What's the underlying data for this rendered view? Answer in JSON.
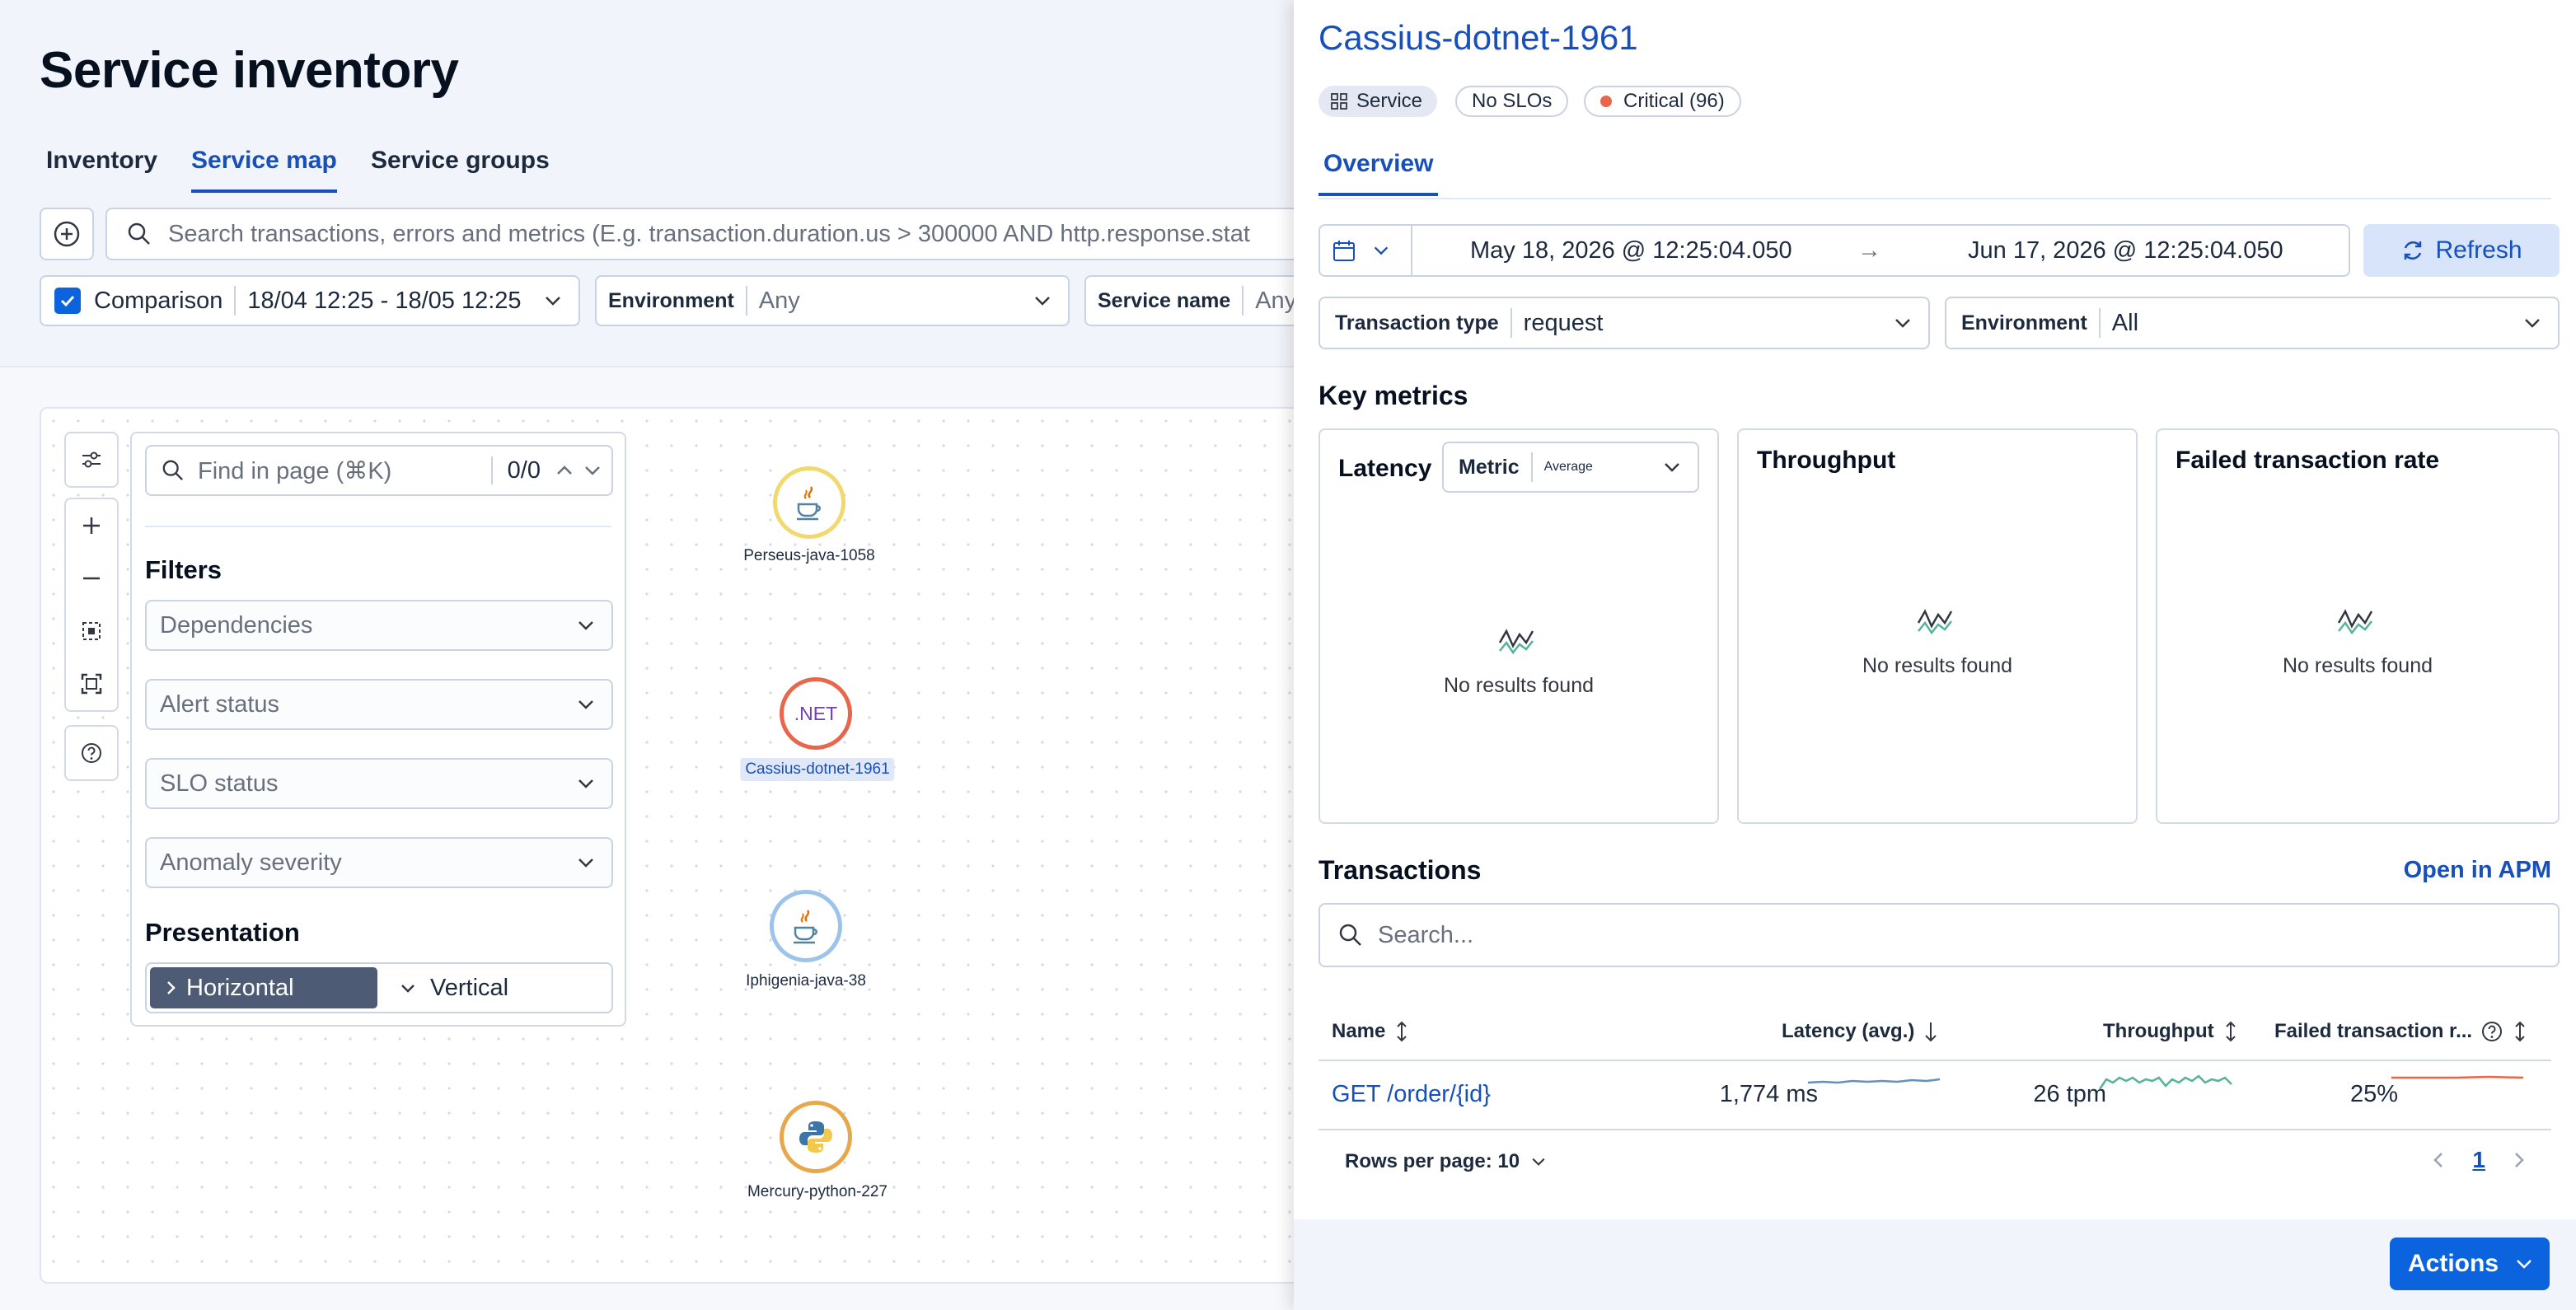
{
  "app": {
    "page_title": "Service inventory",
    "tabs": [
      {
        "label": "Inventory"
      },
      {
        "label": "Service map"
      },
      {
        "label": "Service groups"
      }
    ],
    "search": {
      "placeholder": "Search transactions, errors and metrics (E.g. transaction.duration.us > 300000 AND http.response.stat"
    },
    "comparison": {
      "label": "Comparison",
      "range": "18/04 12:25 - 18/05 12:25"
    },
    "environment_filter": {
      "label": "Environment",
      "value": "Any"
    },
    "service_name_filter": {
      "label": "Service name",
      "value": "Any"
    }
  },
  "map_panel": {
    "find_placeholder": "Find in page (⌘K)",
    "find_count": "0/0",
    "filters_title": "Filters",
    "filters": [
      "Dependencies",
      "Alert status",
      "SLO status",
      "Anomaly severity"
    ],
    "presentation_title": "Presentation",
    "presentation_options": [
      "Horizontal",
      "Vertical"
    ],
    "selected_presentation": "Horizontal"
  },
  "nodes": [
    {
      "label": "Perseus-java-1058",
      "icon": "java-icon",
      "ring_color": "#f1d86f"
    },
    {
      "label": "Cassius-dotnet-1961",
      "icon": "dotnet-icon",
      "icon_text": ".NET",
      "ring_color": "#e7664c"
    },
    {
      "label": "Iphigenia-java-38",
      "icon": "java-icon",
      "ring_color": "#9cc3ea"
    },
    {
      "label": "Mercury-python-227",
      "icon": "python-icon",
      "ring_color": "#e7a84c"
    }
  ],
  "flyout": {
    "title": "Cassius-dotnet-1961",
    "badges": {
      "service": "Service",
      "slo": "No SLOs",
      "critical": "Critical (96)"
    },
    "tab": "Overview",
    "date_start": "May 18, 2026 @ 12:25:04.050",
    "date_arrow": "→",
    "date_end": "Jun 17, 2026 @ 12:25:04.050",
    "refresh_label": "Refresh",
    "transaction_type": {
      "label": "Transaction type",
      "value": "request"
    },
    "environment": {
      "label": "Environment",
      "value": "All"
    },
    "key_metrics_title": "Key metrics",
    "latency": {
      "title": "Latency",
      "metric_label": "Metric",
      "metric_value": "Average",
      "empty": "No results found"
    },
    "throughput": {
      "title": "Throughput",
      "empty": "No results found"
    },
    "failed_rate": {
      "title": "Failed transaction rate",
      "empty": "No results found"
    },
    "transactions_title": "Transactions",
    "open_in_apm": "Open in APM",
    "search_placeholder": "Search...",
    "columns": {
      "name": "Name",
      "latency": "Latency (avg.)",
      "throughput": "Throughput",
      "failed": "Failed transaction r..."
    },
    "rows": [
      {
        "name": "GET /order/{id}",
        "latency": "1,774 ms",
        "throughput": "26 tpm",
        "failed": "25%"
      }
    ],
    "rows_per_page": "Rows per page: 10",
    "current_page": "1",
    "actions_label": "Actions",
    "colors": {
      "accent": "#1750ba",
      "primary_button": "#0b64dd",
      "critical": "#e7664c",
      "sparkline": "#54b399"
    }
  }
}
